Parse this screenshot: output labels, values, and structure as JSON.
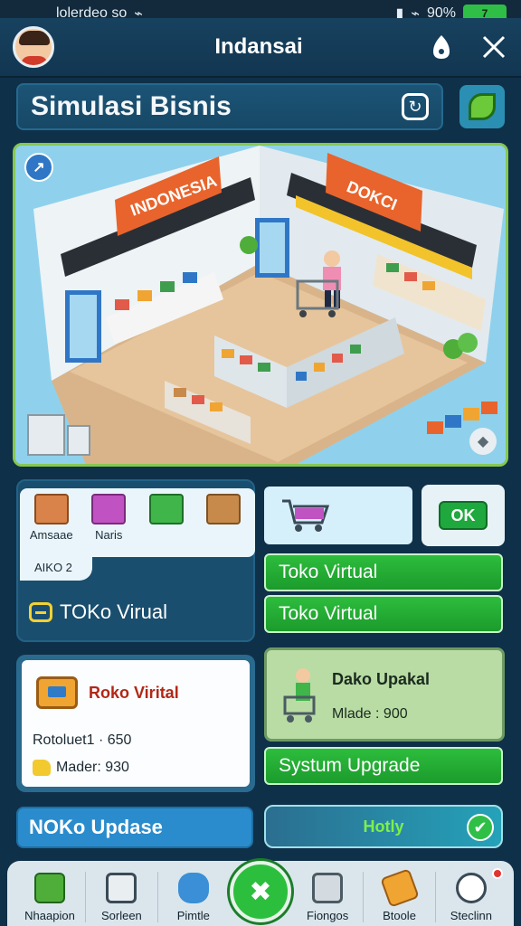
{
  "status_bar": {
    "carrier": "lolerdeo so",
    "battery": "90%",
    "battery_short": "7"
  },
  "app_bar": {
    "title": "Indansai"
  },
  "header": {
    "title": "Simulasi Bisnis"
  },
  "scene": {
    "sign_left": "INDONESIA",
    "sign_right": "DOKCI",
    "sign_right_sub": "DOKCI"
  },
  "inventory": {
    "items": [
      {
        "label": "Amsaae",
        "icon": "crate-icon",
        "color": "#d9834a"
      },
      {
        "label": "Naris",
        "icon": "box-icon",
        "color": "#c052c2"
      },
      {
        "label": "",
        "icon": "basket-icon",
        "color": "#3fb54a"
      },
      {
        "label": "",
        "icon": "cardboard-icon",
        "color": "#c88a4a"
      }
    ],
    "sub_label": "AIKO 2",
    "link_label": "TOKo Virual"
  },
  "actions": {
    "ok_label": "OK",
    "bars": [
      "Toko Virtual",
      "Toko Virtual"
    ]
  },
  "business_card": {
    "title": "Roko Virital",
    "line1": "Rotoluet1 · 650",
    "line2": "Mader: 930"
  },
  "upgrade_card": {
    "title": "Dako Upakal",
    "subtitle": "Mlade : 900"
  },
  "system_upgrade": {
    "label": "Systum Upgrade"
  },
  "update_bar": {
    "label": "NOKo Updase"
  },
  "hotkey_bar": {
    "label": "Hotly"
  },
  "bottom_nav": {
    "items": [
      {
        "label": "Nhaapion",
        "icon": "house-icon"
      },
      {
        "label": "Sorleen",
        "icon": "monitor-icon"
      },
      {
        "label": "Pimtle",
        "icon": "can-icon"
      },
      {
        "label": "Fiongos",
        "icon": "kiosk-icon"
      },
      {
        "label": "Btoole",
        "icon": "tool-icon"
      },
      {
        "label": "Steclinn",
        "icon": "settings-icon"
      }
    ]
  },
  "colors": {
    "background": "#0f3049",
    "accent_green": "#2cbf3e",
    "accent_blue": "#2a8ccc",
    "scene_border": "#86c850"
  }
}
